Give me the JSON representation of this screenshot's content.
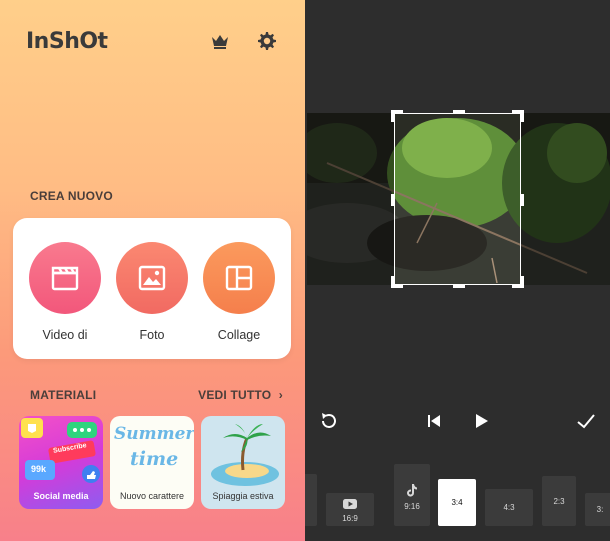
{
  "left_app": {
    "logo": "InShOt",
    "header_icons": [
      "crown-icon",
      "gear-icon"
    ],
    "create_section": {
      "title": "CREA NUOVO",
      "buttons": [
        {
          "label": "Video di",
          "icon": "clapperboard-icon",
          "color": "#f2577b"
        },
        {
          "label": "Foto",
          "icon": "image-icon",
          "color": "#f16a62"
        },
        {
          "label": "Collage",
          "icon": "collage-icon",
          "color": "#f57f4c"
        }
      ]
    },
    "materials_section": {
      "title": "MATERIALI",
      "see_all": "VEDI TUTTO",
      "items": [
        {
          "label": "Social media",
          "badge_count": "99k",
          "sticker": "Subscribe"
        },
        {
          "label": "Nuovo carattere",
          "art_text_1": "Summer",
          "art_text_2": "time"
        },
        {
          "label": "Spiaggia estiva"
        }
      ]
    }
  },
  "right_editor": {
    "controls": [
      "rotate-reset-icon",
      "skip-back-icon",
      "play-icon",
      "check-icon"
    ],
    "aspect_ratios": [
      {
        "label": "",
        "icon": ""
      },
      {
        "label": "16:9",
        "icon": "youtube-icon"
      },
      {
        "label": "9:16",
        "icon": "tiktok-icon"
      },
      {
        "label": "3:4",
        "icon": "",
        "selected": true
      },
      {
        "label": "4:3",
        "icon": ""
      },
      {
        "label": "2:3",
        "icon": ""
      },
      {
        "label": "3:",
        "icon": ""
      }
    ]
  }
}
